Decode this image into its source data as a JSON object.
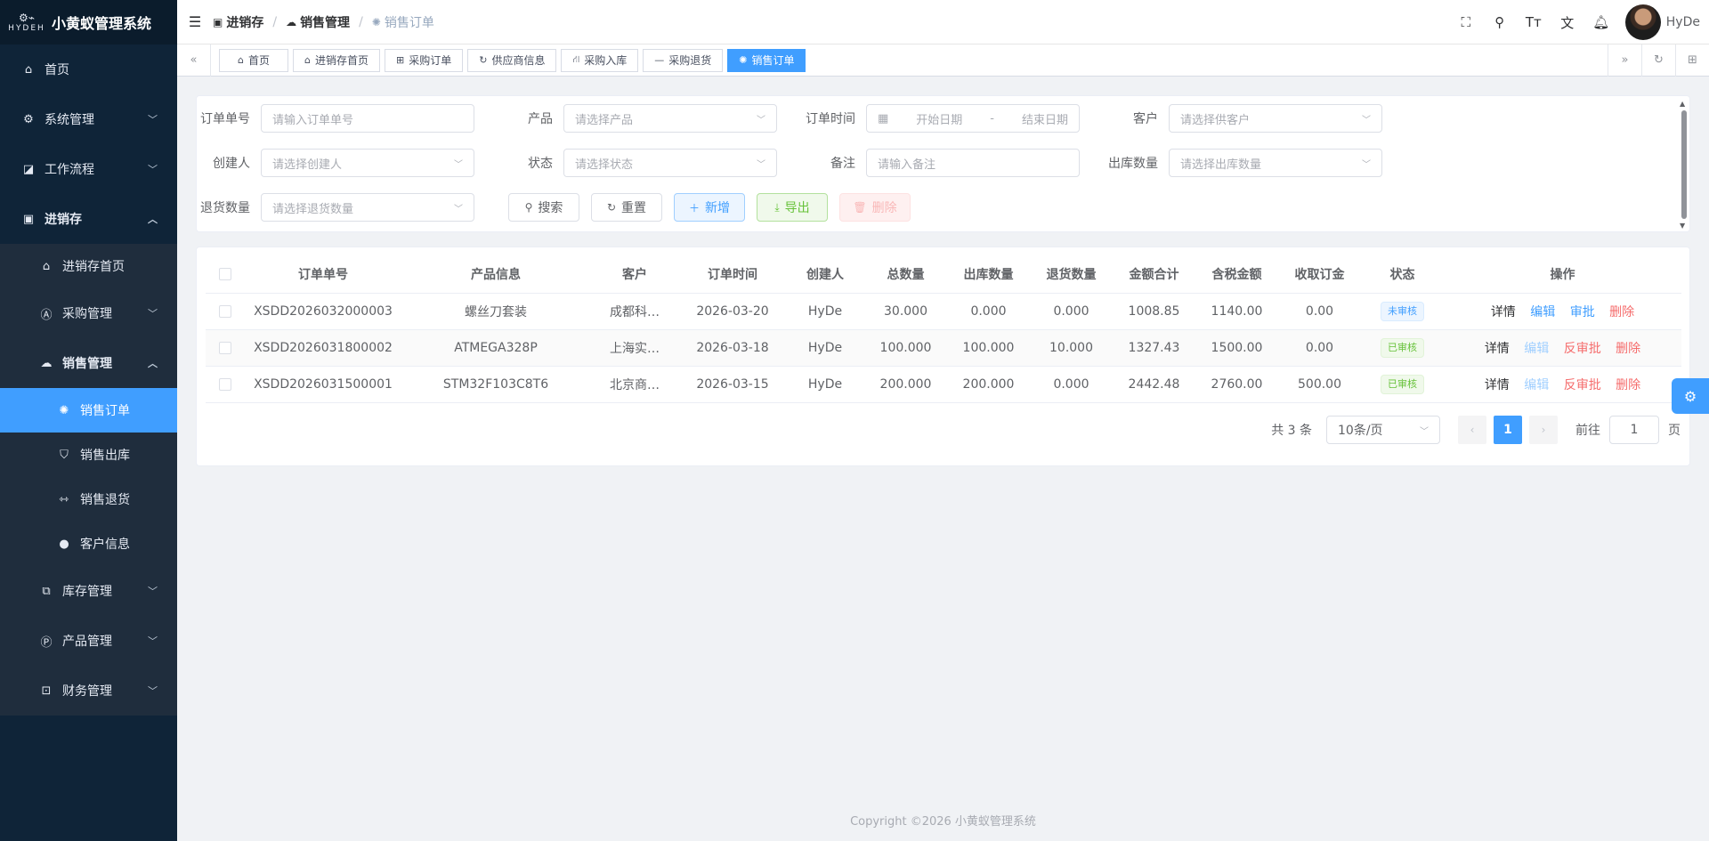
{
  "brand": {
    "logo_text": "HYDEH",
    "title": "小黄蚁管理系统"
  },
  "sidebar": {
    "items": [
      {
        "label": "首页",
        "icon": "home-icon"
      },
      {
        "label": "系统管理",
        "icon": "gear-icon"
      },
      {
        "label": "工作流程",
        "icon": "workflow-icon"
      },
      {
        "label": "进销存",
        "icon": "inventory-icon"
      },
      {
        "label": "进销存首页",
        "icon": "home-icon"
      },
      {
        "label": "采购管理",
        "icon": "purchase-icon"
      },
      {
        "label": "销售管理",
        "icon": "cloud-icon"
      },
      {
        "label": "销售订单",
        "icon": "order-icon"
      },
      {
        "label": "销售出库",
        "icon": "bag-icon"
      },
      {
        "label": "销售退货",
        "icon": "return-icon"
      },
      {
        "label": "客户信息",
        "icon": "user-icon"
      },
      {
        "label": "库存管理",
        "icon": "stock-icon"
      },
      {
        "label": "产品管理",
        "icon": "product-icon"
      },
      {
        "label": "财务管理",
        "icon": "finance-icon"
      }
    ]
  },
  "header": {
    "breadcrumb": [
      "进销存",
      "销售管理",
      "销售订单"
    ],
    "username": "HyDe"
  },
  "tags": [
    "首页",
    "进销存首页",
    "采购订单",
    "供应商信息",
    "采购入库",
    "采购退货",
    "销售订单"
  ],
  "search": {
    "order_no": {
      "label": "订单单号",
      "placeholder": "请输入订单单号"
    },
    "product": {
      "label": "产品",
      "placeholder": "请选择产品"
    },
    "order_time": {
      "label": "订单时间",
      "start": "开始日期",
      "dash": "-",
      "end": "结束日期"
    },
    "customer": {
      "label": "客户",
      "placeholder": "请选择供客户"
    },
    "creator": {
      "label": "创建人",
      "placeholder": "请选择创建人"
    },
    "status": {
      "label": "状态",
      "placeholder": "请选择状态"
    },
    "remark": {
      "label": "备注",
      "placeholder": "请输入备注"
    },
    "out_qty": {
      "label": "出库数量",
      "placeholder": "请选择出库数量"
    },
    "return_qty": {
      "label": "退货数量",
      "placeholder": "请选择退货数量"
    },
    "buttons": {
      "search": "搜索",
      "reset": "重置",
      "add": "新增",
      "export": "导出",
      "delete": "删除"
    }
  },
  "table": {
    "headers": [
      "订单单号",
      "产品信息",
      "客户",
      "订单时间",
      "创建人",
      "总数量",
      "出库数量",
      "退货数量",
      "金额合计",
      "含税金额",
      "收取订金",
      "状态",
      "操作"
    ],
    "rows": [
      {
        "order_no": "XSDD2026032000003",
        "product": "螺丝刀套装",
        "customer": "成都科…",
        "date": "2026-03-20",
        "creator": "HyDe",
        "total": "30.000",
        "out": "0.000",
        "ret": "0.000",
        "amount": "1008.85",
        "tax_amount": "1140.00",
        "deposit": "0.00",
        "status": "未审核"
      },
      {
        "order_no": "XSDD2026031800002",
        "product": "ATMEGA328P",
        "customer": "上海实…",
        "date": "2026-03-18",
        "creator": "HyDe",
        "total": "100.000",
        "out": "100.000",
        "ret": "10.000",
        "amount": "1327.43",
        "tax_amount": "1500.00",
        "deposit": "0.00",
        "status": "已审核"
      },
      {
        "order_no": "XSDD2026031500001",
        "product": "STM32F103C8T6",
        "customer": "北京商…",
        "date": "2026-03-15",
        "creator": "HyDe",
        "total": "200.000",
        "out": "200.000",
        "ret": "0.000",
        "amount": "2442.48",
        "tax_amount": "2760.00",
        "deposit": "500.00",
        "status": "已审核"
      }
    ],
    "ops": {
      "detail": "详情",
      "edit": "编辑",
      "approve": "审批",
      "unapprove": "反审批",
      "delete": "删除"
    }
  },
  "pager": {
    "total": "共 3 条",
    "page_size": "10条/页",
    "current": "1",
    "goto_prefix": "前往",
    "goto_value": "1",
    "goto_suffix": "页"
  },
  "footer": "Copyright ©2026 小黄蚁管理系统",
  "colors": {
    "primary": "#409eff",
    "sidebar_bg": "#0f2438",
    "success": "#67c23a",
    "danger": "#f56c6c"
  }
}
